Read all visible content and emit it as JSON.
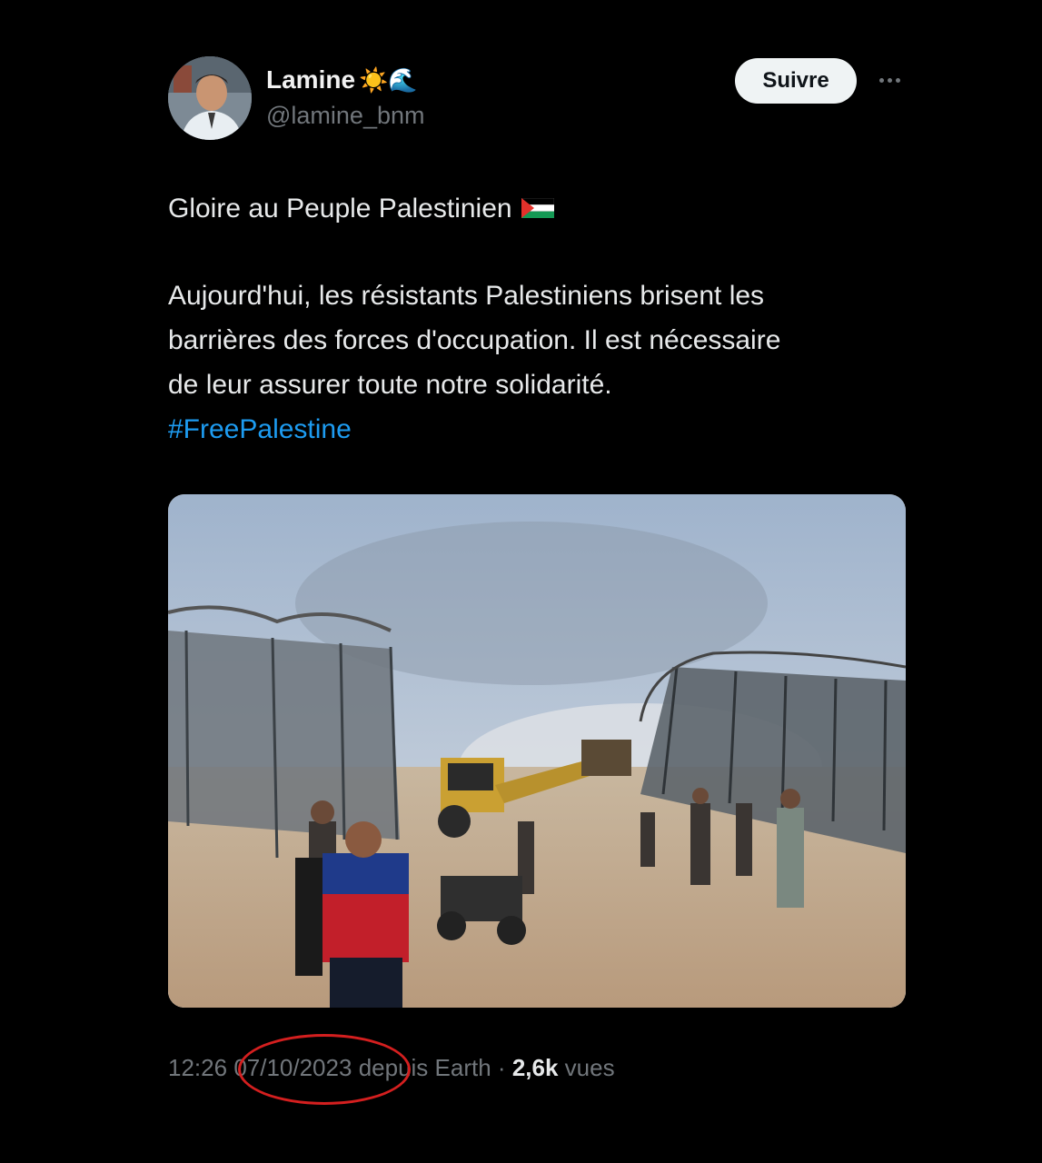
{
  "author": {
    "display_name": "Lamine",
    "name_emojis": "☀️🌊",
    "handle": "@lamine_bnm",
    "avatar": "user-avatar-photo"
  },
  "actions": {
    "follow_label": "Suivre",
    "more_icon": "more-icon"
  },
  "tweet": {
    "line1": "Gloire au Peuple Palestinien",
    "line2": "Aujourd'hui, les résistants Palestiniens brisent les",
    "line3": "barrières des forces d'occupation. Il est nécessaire",
    "line4": "de leur assurer toute notre solidarité.",
    "hashtag": "#FreePalestine",
    "flag_icon": "palestine-flag-icon"
  },
  "meta": {
    "time": "12:26",
    "date": "07/10/2023",
    "source": "depuis Earth",
    "separator": "·",
    "views_count": "2,6k",
    "views_label": "vues"
  },
  "colors": {
    "background": "#000000",
    "text": "#e7e9ea",
    "muted": "#71767b",
    "link": "#1d9bf0",
    "annotation": "#d41f1f"
  }
}
